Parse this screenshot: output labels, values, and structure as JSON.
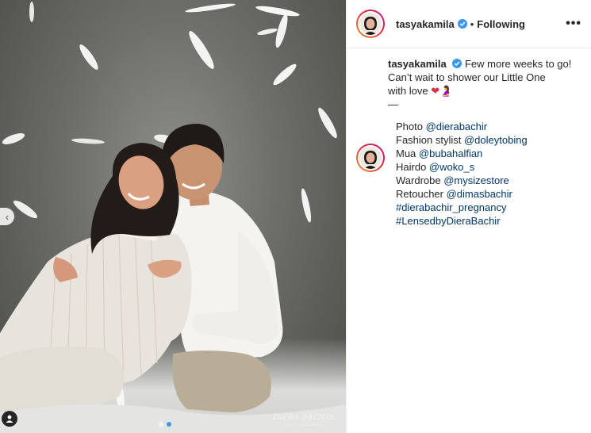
{
  "post": {
    "username": "tasyakamila",
    "separator": "•",
    "follow_status": "Following",
    "more_label": "•••",
    "caption": {
      "line1": "Few more weeks to go!",
      "line2": "Can’t wait to shower our Little One",
      "line3": "with love",
      "emoji_heart": "❤",
      "emoji_pregnant": "🤰"
    },
    "divider": "—",
    "credits": [
      {
        "label": "Photo ",
        "value": "@dierabachir"
      },
      {
        "label": "Fashion stylist ",
        "value": "@doleytobing"
      },
      {
        "label": "Mua ",
        "value": "@bubahalfian"
      },
      {
        "label": "Hairdo ",
        "value": "@woko_s"
      },
      {
        "label": "Wardrobe ",
        "value": "@mysizestore"
      },
      {
        "label": "Retoucher ",
        "value": "@dimasbachir"
      }
    ],
    "hashtags": [
      "#dierabachir_pregnancy",
      "#LensedbyDieraBachir"
    ],
    "carousel": {
      "total_slides": 2,
      "active_slide": 2
    },
    "watermark": {
      "main": "DIERA BACHIR",
      "sub": "PHOTOGRAPHY"
    }
  },
  "colors": {
    "link": "#00376b",
    "verified": "#3897f0",
    "text": "#262626",
    "border": "#efefef"
  },
  "icons": {
    "prev_arrow": "chevron-left-icon",
    "tag": "person-tag-icon",
    "verified": "verified-badge-icon",
    "more": "more-options-icon"
  }
}
